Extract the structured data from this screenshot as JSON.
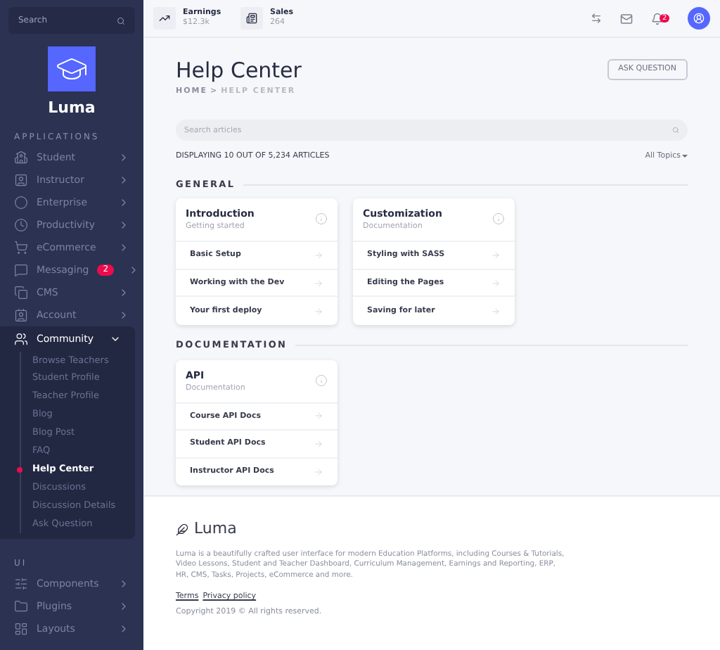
{
  "sidebar": {
    "search": {
      "placeholder": "Search"
    },
    "brand": "Luma",
    "sections": [
      {
        "title": "APPLICATIONS",
        "items": [
          {
            "label": "Student",
            "expanded": false
          },
          {
            "label": "Instructor",
            "expanded": false
          },
          {
            "label": "Enterprise",
            "expanded": false
          },
          {
            "label": "Productivity",
            "expanded": false
          },
          {
            "label": "eCommerce",
            "expanded": false
          },
          {
            "label": "Messaging",
            "badge": "2",
            "expanded": false
          },
          {
            "label": "CMS",
            "expanded": false
          },
          {
            "label": "Account",
            "expanded": false
          },
          {
            "label": "Community",
            "expanded": true,
            "children": [
              {
                "label": "Browse Teachers",
                "selected": false
              },
              {
                "label": "Student Profile",
                "selected": false
              },
              {
                "label": "Teacher Profile",
                "selected": false
              },
              {
                "label": "Blog",
                "selected": false
              },
              {
                "label": "Blog Post",
                "selected": false
              },
              {
                "label": "FAQ",
                "selected": false
              },
              {
                "label": "Help Center",
                "selected": true
              },
              {
                "label": "Discussions",
                "selected": false
              },
              {
                "label": "Discussion Details",
                "selected": false
              },
              {
                "label": "Ask Question",
                "selected": false
              }
            ]
          }
        ]
      },
      {
        "title": "UI",
        "items": [
          {
            "label": "Components",
            "expanded": false
          },
          {
            "label": "Plugins",
            "expanded": false
          },
          {
            "label": "Layouts",
            "expanded": false
          }
        ]
      }
    ]
  },
  "topbar": {
    "stats": [
      {
        "label": "Earnings",
        "value": "$12.3k"
      },
      {
        "label": "Sales",
        "value": "264"
      }
    ],
    "notifications": "2"
  },
  "page": {
    "title": "Help Center",
    "breadcrumb": [
      "HOME",
      "HELP CENTER"
    ],
    "breadcrumb_separator": ">",
    "button": "ASK QUESTION",
    "search": {
      "placeholder": "Search articles"
    },
    "count": "DISPLAYING 10 OUT OF 5,234 ARTICLES",
    "filter": "All Topics",
    "sections": [
      {
        "title": "GENERAL",
        "cards": [
          {
            "title": "Introduction",
            "subtitle": "Getting started",
            "links": [
              "Basic Setup",
              "Working with the Dev",
              "Your first deploy"
            ]
          },
          {
            "title": "Customization",
            "subtitle": "Documentation",
            "links": [
              "Styling with SASS",
              "Editing the Pages",
              "Saving for later"
            ]
          }
        ]
      },
      {
        "title": "DOCUMENTATION",
        "cards": [
          {
            "title": "API",
            "subtitle": "Documentation",
            "links": [
              "Course API Docs",
              "Student API Docs",
              "Instructor API Docs"
            ]
          }
        ]
      }
    ]
  },
  "footer": {
    "brand": "Luma",
    "description": "Luma is a beautifully crafted user interface for modern Education Platforms, including Courses & Tutorials, Video Lessons, Student and Teacher Dashboard, Curriculum Management, Earnings and Reporting, ERP, HR, CMS, Tasks, Projects, eCommerce and more.",
    "links": [
      "Terms",
      "Privacy policy"
    ],
    "copyright": "Copyright 2019 © All rights reserved."
  }
}
